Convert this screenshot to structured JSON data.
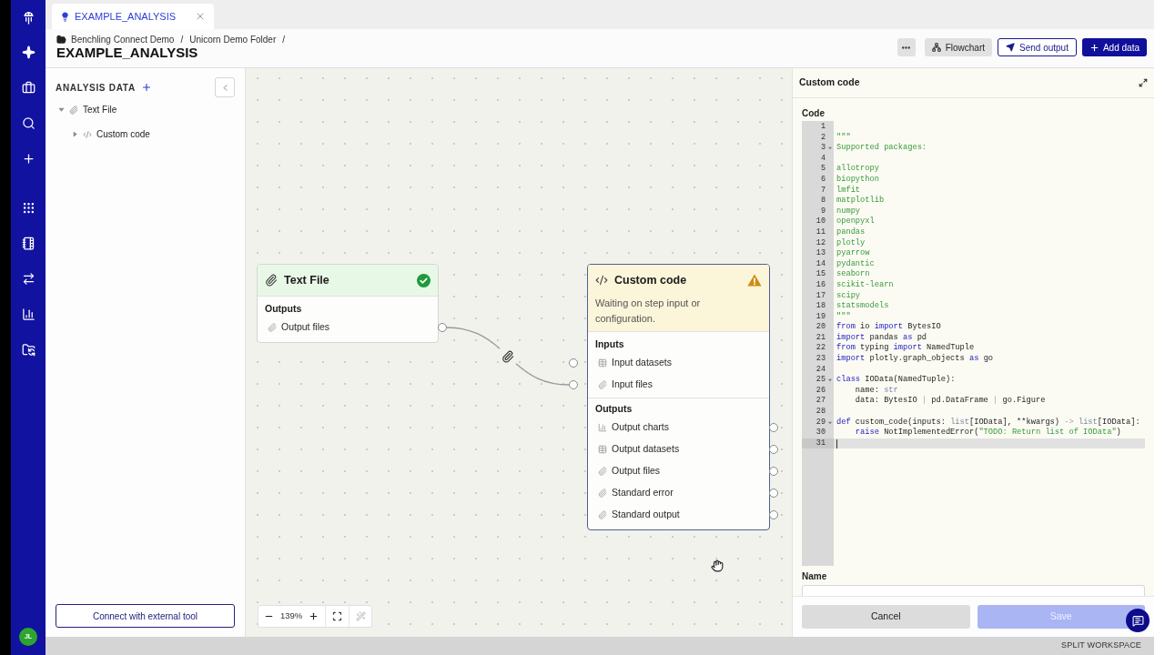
{
  "rail": {
    "avatar": "JL"
  },
  "tabs": [
    {
      "label": "EXAMPLE_ANALYSIS",
      "selected": true
    }
  ],
  "header": {
    "breadcrumbs": [
      {
        "label": "Benchling Connect Demo",
        "separator": "/"
      },
      {
        "label": "Unicorn Demo Folder",
        "separator": "/"
      }
    ],
    "title": "EXAMPLE_ANALYSIS",
    "actions": [
      {
        "kind": "more"
      },
      {
        "kind": "secondary",
        "label": "Flowchart"
      },
      {
        "kind": "outline",
        "label": "Send output"
      },
      {
        "kind": "primary",
        "label": "Add data"
      }
    ]
  },
  "sidebar": {
    "title": "ANALYSIS DATA",
    "tree": [
      {
        "label": "Text File",
        "kind": "file",
        "expanded": true,
        "children": [
          {
            "label": "Custom code",
            "kind": "code",
            "expanded": false
          }
        ]
      }
    ],
    "footer_button": "Connect with external tool"
  },
  "canvas": {
    "nodes": [
      {
        "title": "Text File",
        "kind": "file",
        "ready": true,
        "selected": false,
        "sections": [
          {
            "title": "Outputs",
            "kind": "output",
            "ports": [
              {
                "label": "Output files",
                "kind": "file"
              }
            ]
          }
        ]
      },
      {
        "title": "Custom code",
        "kind": "code",
        "ready": false,
        "selected": true,
        "message": "Waiting on step input or configuration.",
        "sections": [
          {
            "title": "Inputs",
            "kind": "input",
            "ports": [
              {
                "label": "Input datasets",
                "kind": "dataset"
              },
              {
                "label": "Input files",
                "kind": "file"
              }
            ]
          },
          {
            "title": "Outputs",
            "kind": "output",
            "ports": [
              {
                "label": "Output charts",
                "kind": "chart"
              },
              {
                "label": "Output datasets",
                "kind": "dataset"
              },
              {
                "label": "Output files",
                "kind": "file"
              },
              {
                "label": "Standard error",
                "kind": "file"
              },
              {
                "label": "Standard output",
                "kind": "file"
              }
            ]
          }
        ]
      }
    ],
    "edges": [
      {
        "kind": "file"
      }
    ],
    "zoom": {
      "reading": "139%",
      "tools": [
        {
          "kind": "fit",
          "disabled": false
        },
        {
          "kind": "layout",
          "disabled": true
        }
      ]
    }
  },
  "panel": {
    "title": "Custom code",
    "code_label": "Code",
    "lines": [
      {
        "number": "1",
        "foldable": false,
        "active": false
      },
      {
        "number": "2",
        "foldable": false,
        "active": false,
        "tokens": [
          {
            "text": "\"\"\"",
            "kind": "string"
          }
        ]
      },
      {
        "number": "3",
        "foldable": true,
        "active": false,
        "tokens": [
          {
            "text": "Supported packages:",
            "kind": "string"
          }
        ]
      },
      {
        "number": "4",
        "foldable": false,
        "active": false
      },
      {
        "number": "5",
        "foldable": false,
        "active": false,
        "tokens": [
          {
            "text": "allotropy",
            "kind": "string"
          }
        ]
      },
      {
        "number": "6",
        "foldable": false,
        "active": false,
        "tokens": [
          {
            "text": "biopython",
            "kind": "string"
          }
        ]
      },
      {
        "number": "7",
        "foldable": false,
        "active": false,
        "tokens": [
          {
            "text": "lmfit",
            "kind": "string"
          }
        ]
      },
      {
        "number": "8",
        "foldable": false,
        "active": false,
        "tokens": [
          {
            "text": "matplotlib",
            "kind": "string"
          }
        ]
      },
      {
        "number": "9",
        "foldable": false,
        "active": false,
        "tokens": [
          {
            "text": "numpy",
            "kind": "string"
          }
        ]
      },
      {
        "number": "10",
        "foldable": false,
        "active": false,
        "tokens": [
          {
            "text": "openpyxl",
            "kind": "string"
          }
        ]
      },
      {
        "number": "11",
        "foldable": false,
        "active": false,
        "tokens": [
          {
            "text": "pandas",
            "kind": "string"
          }
        ]
      },
      {
        "number": "12",
        "foldable": false,
        "active": false,
        "tokens": [
          {
            "text": "plotly",
            "kind": "string"
          }
        ]
      },
      {
        "number": "13",
        "foldable": false,
        "active": false,
        "tokens": [
          {
            "text": "pyarrow",
            "kind": "string"
          }
        ]
      },
      {
        "number": "14",
        "foldable": false,
        "active": false,
        "tokens": [
          {
            "text": "pydantic",
            "kind": "string"
          }
        ]
      },
      {
        "number": "15",
        "foldable": false,
        "active": false,
        "tokens": [
          {
            "text": "seaborn",
            "kind": "string"
          }
        ]
      },
      {
        "number": "16",
        "foldable": false,
        "active": false,
        "tokens": [
          {
            "text": "scikit-learn",
            "kind": "string"
          }
        ]
      },
      {
        "number": "17",
        "foldable": false,
        "active": false,
        "tokens": [
          {
            "text": "scipy",
            "kind": "string"
          }
        ]
      },
      {
        "number": "18",
        "foldable": false,
        "active": false,
        "tokens": [
          {
            "text": "statsmodels",
            "kind": "string"
          }
        ]
      },
      {
        "number": "19",
        "foldable": false,
        "active": false,
        "tokens": [
          {
            "text": "\"\"\"",
            "kind": "string"
          }
        ]
      },
      {
        "number": "20",
        "foldable": false,
        "active": false,
        "tokens": [
          {
            "text": "from",
            "kind": "keyword"
          },
          {
            "text": " io ",
            "kind": "plain"
          },
          {
            "text": "import",
            "kind": "keyword"
          },
          {
            "text": " BytesIO",
            "kind": "plain"
          }
        ]
      },
      {
        "number": "21",
        "foldable": false,
        "active": false,
        "tokens": [
          {
            "text": "import",
            "kind": "keyword"
          },
          {
            "text": " pandas ",
            "kind": "plain"
          },
          {
            "text": "as",
            "kind": "keyword"
          },
          {
            "text": " pd",
            "kind": "plain"
          }
        ]
      },
      {
        "number": "22",
        "foldable": false,
        "active": false,
        "tokens": [
          {
            "text": "from",
            "kind": "keyword"
          },
          {
            "text": " typing ",
            "kind": "plain"
          },
          {
            "text": "import",
            "kind": "keyword"
          },
          {
            "text": " NamedTuple",
            "kind": "plain"
          }
        ]
      },
      {
        "number": "23",
        "foldable": false,
        "active": false,
        "tokens": [
          {
            "text": "import",
            "kind": "keyword"
          },
          {
            "text": " plotly.graph_objects ",
            "kind": "plain"
          },
          {
            "text": "as",
            "kind": "keyword"
          },
          {
            "text": " go",
            "kind": "plain"
          }
        ]
      },
      {
        "number": "24",
        "foldable": false,
        "active": false
      },
      {
        "number": "25",
        "foldable": true,
        "active": false,
        "tokens": [
          {
            "text": "class",
            "kind": "keyword"
          },
          {
            "text": " IOData(NamedTuple):",
            "kind": "plain"
          }
        ]
      },
      {
        "number": "26",
        "foldable": false,
        "active": false,
        "tokens": [
          {
            "text": "    name: ",
            "kind": "plain"
          },
          {
            "text": "str",
            "kind": "builtin"
          }
        ]
      },
      {
        "number": "27",
        "foldable": false,
        "active": false,
        "tokens": [
          {
            "text": "    data: BytesIO ",
            "kind": "plain"
          },
          {
            "text": "|",
            "kind": "operator"
          },
          {
            "text": " pd.DataFrame ",
            "kind": "plain"
          },
          {
            "text": "|",
            "kind": "operator"
          },
          {
            "text": " go.Figure",
            "kind": "plain"
          }
        ]
      },
      {
        "number": "28",
        "foldable": false,
        "active": false
      },
      {
        "number": "29",
        "foldable": true,
        "active": false,
        "tokens": [
          {
            "text": "def",
            "kind": "keyword"
          },
          {
            "text": " custom_code(inputs: ",
            "kind": "plain"
          },
          {
            "text": "list",
            "kind": "builtin"
          },
          {
            "text": "[IOData], **kwargs) ",
            "kind": "plain"
          },
          {
            "text": "->",
            "kind": "operator"
          },
          {
            "text": " list",
            "kind": "builtin"
          },
          {
            "text": "[IOData]:",
            "kind": "plain"
          }
        ]
      },
      {
        "number": "30",
        "foldable": false,
        "active": false,
        "tokens": [
          {
            "text": "    raise",
            "kind": "keyword"
          },
          {
            "text": " NotImplementedError(",
            "kind": "plain"
          },
          {
            "text": "\"TODO: Return list of IOData\"",
            "kind": "string"
          },
          {
            "text": ")",
            "kind": "plain"
          }
        ]
      },
      {
        "number": "31",
        "foldable": false,
        "active": true
      }
    ],
    "name_label": "Name",
    "buttons": [
      {
        "label": "Cancel",
        "kind": "secondary",
        "disabled": false
      },
      {
        "label": "Save",
        "kind": "primary",
        "disabled": true
      }
    ]
  },
  "status_bar": {
    "label": "SPLIT WORKSPACE"
  }
}
